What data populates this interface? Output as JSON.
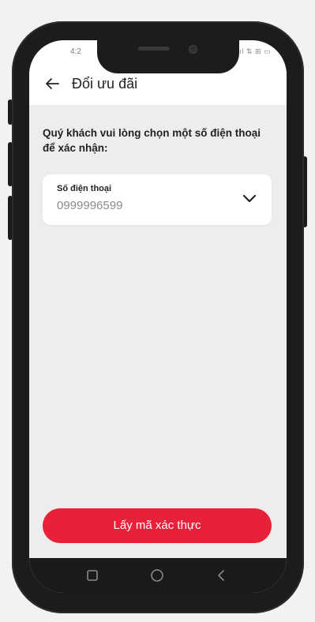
{
  "statusbar": {
    "time": "4:2",
    "icons": "ııl ⇅ ⊞ ▭"
  },
  "header": {
    "title": "Đổi ưu đãi",
    "back_icon": "back-arrow-icon"
  },
  "instruction": "Quý khách vui lòng chọn một số điện thoại để xác nhận:",
  "phone_select": {
    "label": "Số điện thoại",
    "value": "0999996599",
    "icon": "chevron-down-icon"
  },
  "cta": {
    "label": "Lấy mã xác thực"
  },
  "navbar": {
    "recent_icon": "recent-apps-icon",
    "home_icon": "home-icon",
    "back_icon": "nav-back-icon"
  },
  "colors": {
    "accent": "#e8213a",
    "screen_bg": "#ededed",
    "page_bg": "#f1f2f4",
    "phone_frame": "#1c1c1c"
  }
}
